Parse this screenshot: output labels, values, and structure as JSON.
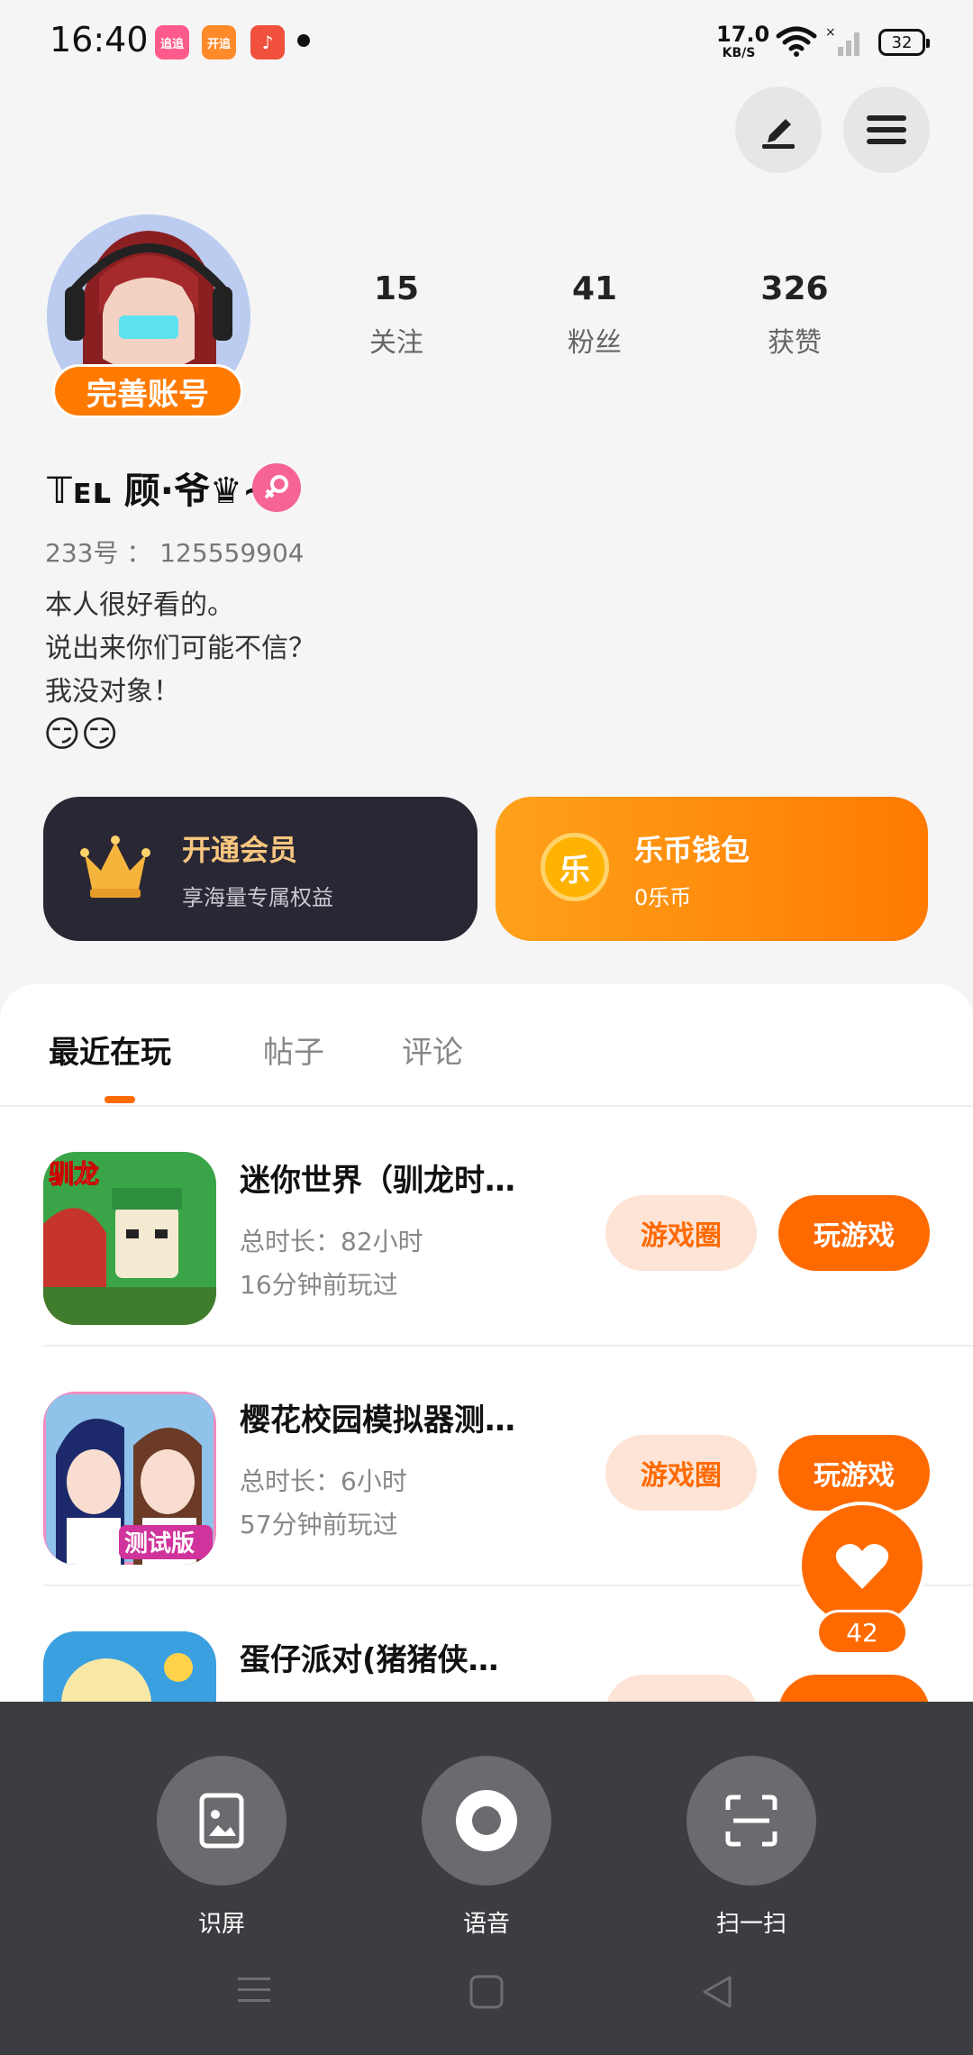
{
  "status_bar": {
    "time": "16:40",
    "net_speed_value": "17.0",
    "net_speed_unit": "KB/S",
    "battery": "32",
    "app_icons": [
      {
        "label": "追追",
        "color": "#ff5a8c"
      },
      {
        "label": "开追",
        "color": "#ff8a2a"
      },
      {
        "label": "♪",
        "color": "#f0503c"
      }
    ]
  },
  "profile": {
    "complete_account": "完善账号",
    "stats": [
      {
        "value": "15",
        "label": "关注"
      },
      {
        "value": "41",
        "label": "粉丝"
      },
      {
        "value": "326",
        "label": "获赞"
      }
    ],
    "nickname": "𝕋ᴇʟ 顾·爷♛~",
    "user_id": "233号 ： 125559904",
    "bio_lines": [
      "本人很好看的。",
      "说出来你们可能不信？",
      "我没对象！"
    ],
    "bio_emoji": "😏😏"
  },
  "cards": {
    "vip_title": "开通会员",
    "vip_sub": "享海量专属权益",
    "wallet_title": "乐币钱包",
    "wallet_sub": "0乐币",
    "coin_symbol": "乐"
  },
  "tabs": [
    {
      "label": "最近在玩"
    },
    {
      "label": "帖子"
    },
    {
      "label": "评论"
    }
  ],
  "games": [
    {
      "title": "迷你世界（驯龙时…",
      "duration": "总时长：82小时",
      "last_played": "16分钟前玩过",
      "circle_label": "游戏圈",
      "play_label": "玩游戏"
    },
    {
      "title": "樱花校园模拟器测…",
      "duration": "总时长：6小时",
      "last_played": "57分钟前玩过",
      "circle_label": "游戏圈",
      "play_label": "玩游戏"
    },
    {
      "title": "蛋仔派对(猪猪侠…",
      "duration": "",
      "last_played": "",
      "circle_label": "",
      "play_label": ""
    }
  ],
  "game_icon_labels": [
    "驯龙",
    "测试版"
  ],
  "like_count": "42",
  "tools": [
    {
      "label": "识屏"
    },
    {
      "label": "语音"
    },
    {
      "label": "扫一扫"
    }
  ],
  "colors": {
    "accent": "#ff6a00",
    "vip_bg": "#2a2735",
    "overlay": "#3c3d41"
  }
}
